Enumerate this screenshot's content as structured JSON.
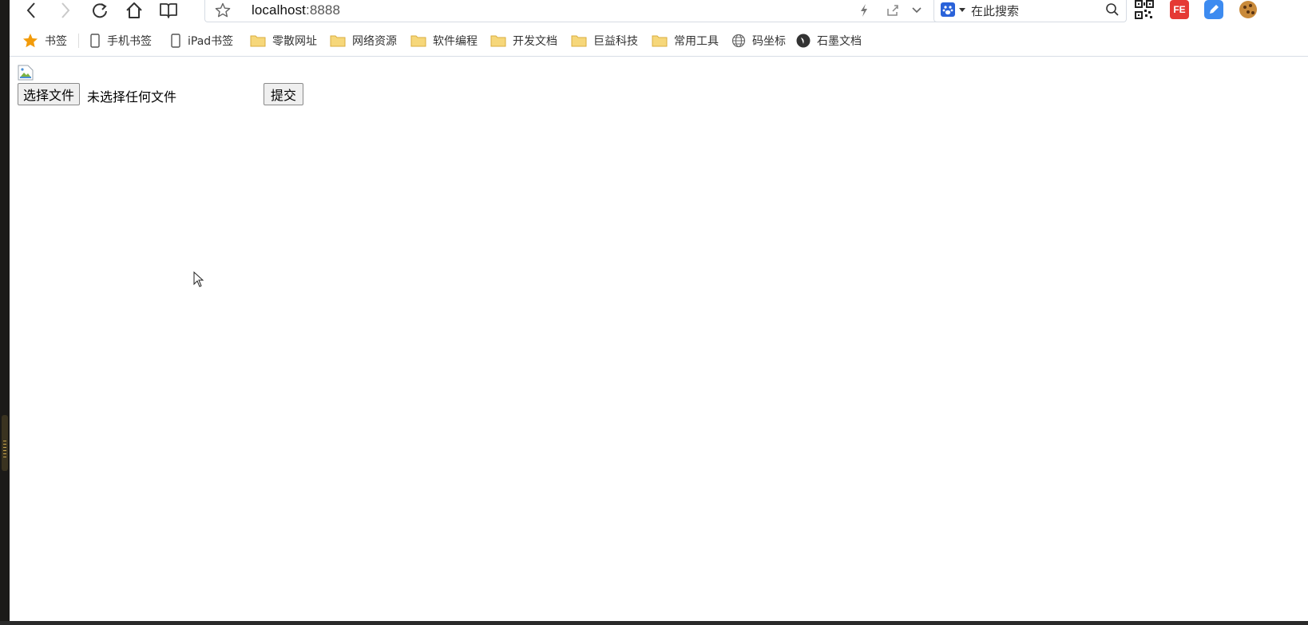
{
  "address_bar": {
    "host": "localhost",
    "port": ":8888"
  },
  "search": {
    "placeholder": "在此搜索"
  },
  "extensions": {
    "fe_label": "FE"
  },
  "bookmarks": [
    {
      "label": "书签",
      "icon": "star-icon"
    },
    {
      "label": "手机书签",
      "icon": "phone-icon"
    },
    {
      "label": "iPad书签",
      "icon": "tablet-icon"
    },
    {
      "label": "零散网址",
      "icon": "folder-icon"
    },
    {
      "label": "网络资源",
      "icon": "folder-icon"
    },
    {
      "label": "软件编程",
      "icon": "folder-icon"
    },
    {
      "label": "开发文档",
      "icon": "folder-icon"
    },
    {
      "label": "巨益科技",
      "icon": "folder-icon"
    },
    {
      "label": "常用工具",
      "icon": "folder-icon"
    },
    {
      "label": "码坐标",
      "icon": "globe-icon"
    },
    {
      "label": "石墨文档",
      "icon": "shimo-icon"
    }
  ],
  "form": {
    "choose_file_label": "选择文件",
    "file_status": "未选择任何文件",
    "submit_label": "提交"
  },
  "colors": {
    "star": "#f29b0a",
    "folder": "#f6d77a",
    "fe_ext": "#e53935",
    "note_ext": "#3d8bf0",
    "engine": "#2a62d9"
  }
}
